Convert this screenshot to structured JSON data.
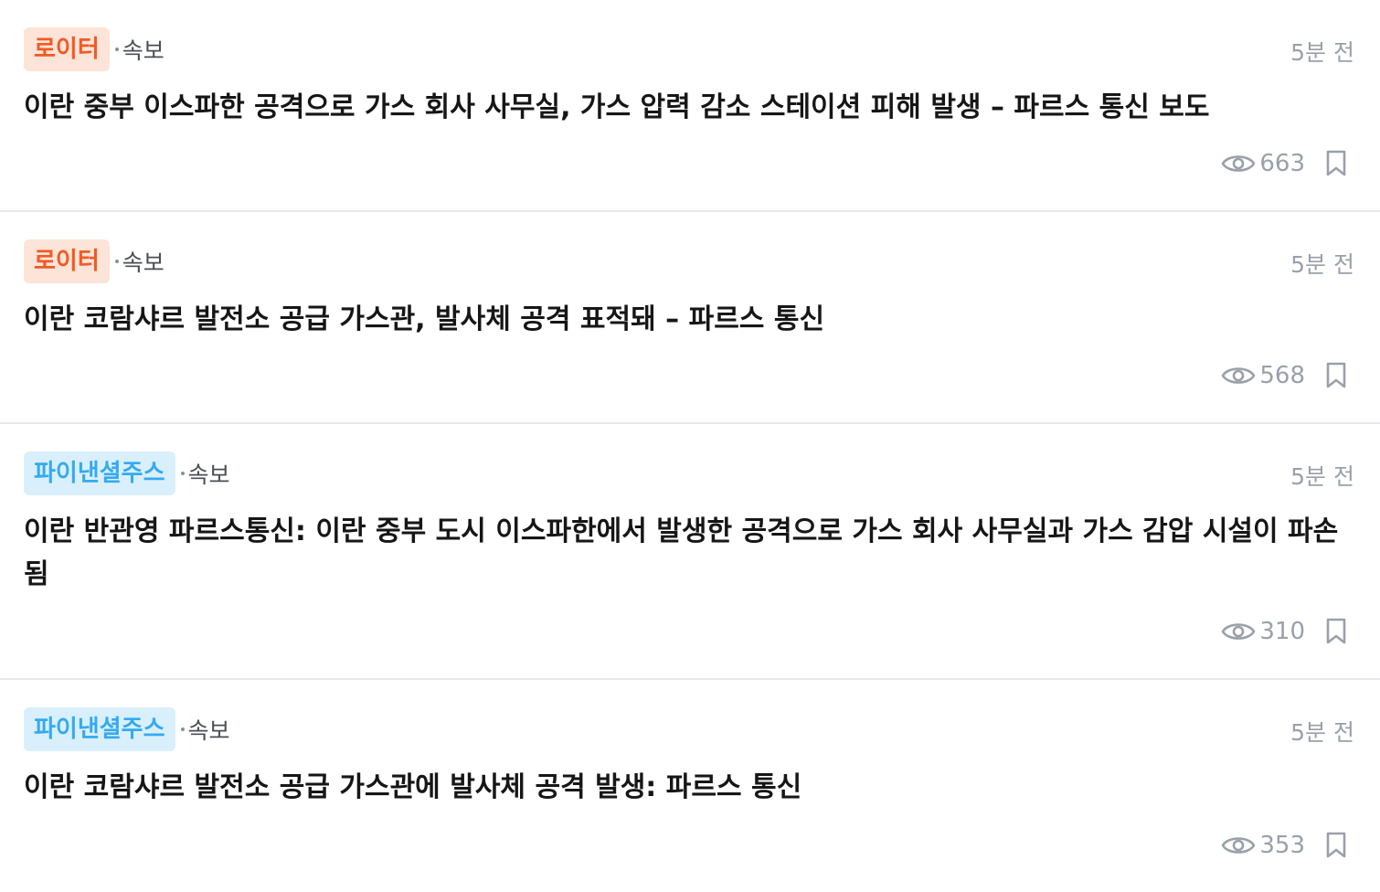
{
  "colors": {
    "reuters_badge_bg": "#fde4d8",
    "reuters_badge_text": "#f15a24",
    "ft_badge_bg": "#d9f0fc",
    "ft_badge_text": "#35aaf0",
    "meta_gray": "#9aa0aa"
  },
  "icons": {
    "views": "eye-icon",
    "bookmark": "bookmark-icon"
  },
  "items": [
    {
      "source": "로이터",
      "category": "속보",
      "time": "5분 전",
      "headline": "이란 중부 이스파한 공격으로 가스 회사 사무실, 가스 압력 감소 스테이션 피해 발생 – 파르스 통신 보도",
      "views": "663"
    },
    {
      "source": "로이터",
      "category": "속보",
      "time": "5분 전",
      "headline": "이란 코람샤르 발전소 공급 가스관, 발사체 공격 표적돼 – 파르스 통신",
      "views": "568"
    },
    {
      "source": "파이낸셜주스",
      "category": "속보",
      "time": "5분 전",
      "headline": "이란 반관영 파르스통신: 이란 중부 도시 이스파한에서 발생한 공격으로 가스 회사 사무실과 가스 감압 시설이 파손됨",
      "views": "310"
    },
    {
      "source": "파이낸셜주스",
      "category": "속보",
      "time": "5분 전",
      "headline": "이란 코람샤르 발전소 공급 가스관에 발사체 공격 발생: 파르스 통신",
      "views": "353"
    }
  ]
}
